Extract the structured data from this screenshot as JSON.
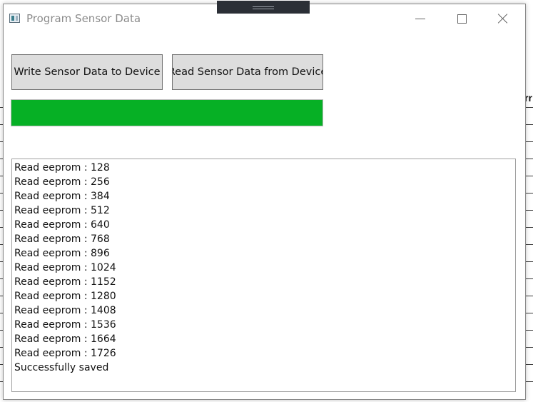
{
  "window": {
    "title": "Program Sensor Data"
  },
  "buttons": {
    "write_label": "Write Sensor Data to Device",
    "read_label": "Read Sensor Data from Device"
  },
  "progress": {
    "value_percent": 100,
    "color": "#06b025"
  },
  "log": {
    "lines": [
      "Read eeprom : 128",
      "Read eeprom : 256",
      "Read eeprom : 384",
      "Read eeprom : 512",
      "Read eeprom : 640",
      "Read eeprom : 768",
      "Read eeprom : 896",
      "Read eeprom : 1024",
      "Read eeprom : 1152",
      "Read eeprom : 1280",
      "Read eeprom : 1408",
      "Read eeprom : 1536",
      "Read eeprom : 1664",
      "Read eeprom : 1726",
      "Successfully saved"
    ]
  },
  "background": {
    "header_fragment": "rr"
  },
  "icons": {
    "app": "app-icon",
    "minimize": "minimize-icon",
    "maximize": "maximize-icon",
    "close": "close-icon"
  }
}
